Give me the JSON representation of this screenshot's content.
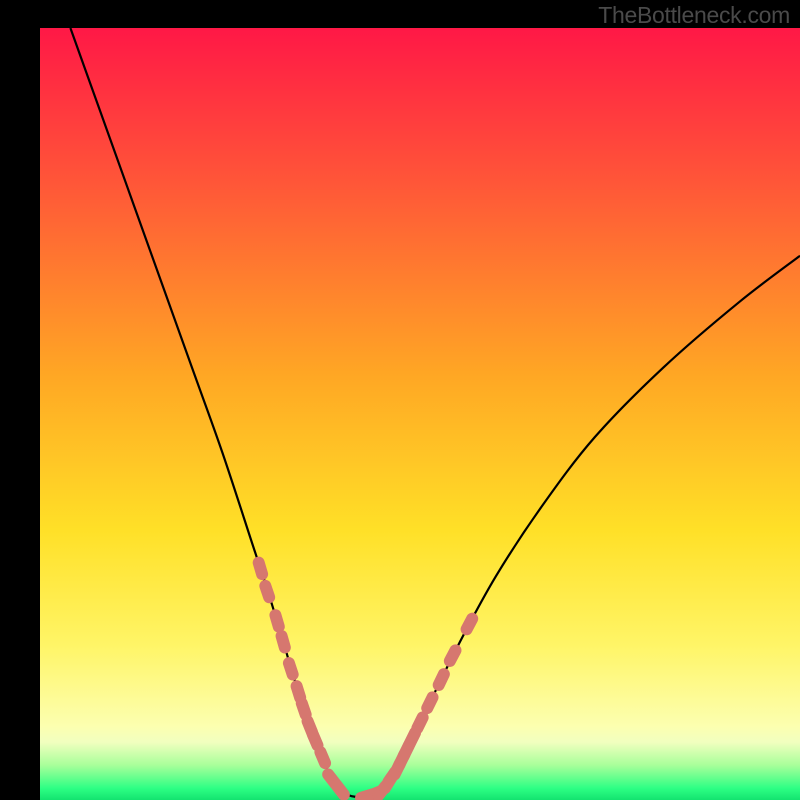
{
  "watermark": "TheBottleneck.com",
  "chart_data": {
    "type": "line",
    "title": "",
    "xlabel": "",
    "ylabel": "",
    "xlim": [
      0,
      100
    ],
    "ylim": [
      0,
      100
    ],
    "series": [
      {
        "name": "curve",
        "x": [
          4,
          8,
          12,
          16,
          20,
          24,
          28,
          30,
          32,
          34,
          36,
          37,
          38,
          39.5,
          41,
          43,
          45,
          47,
          50,
          55,
          60,
          66,
          73,
          82,
          92,
          100
        ],
        "y": [
          100,
          89,
          78,
          67,
          56,
          45,
          33,
          27,
          20.5,
          14,
          8.5,
          6,
          3.5,
          1.3,
          0.5,
          0.5,
          1.2,
          4,
          10,
          20,
          29,
          38,
          47,
          56,
          64.5,
          70.5
        ]
      }
    ],
    "markers_left": {
      "x": [
        29.0,
        29.9,
        31.2,
        32.0,
        33.0,
        34.0,
        34.7,
        35.5,
        36.2,
        37.2,
        38.4,
        39.5
      ],
      "y": [
        30.0,
        27.0,
        23.2,
        20.5,
        17.0,
        14.0,
        11.8,
        9.5,
        7.8,
        5.5,
        2.7,
        1.3
      ]
    },
    "markers_right": {
      "x": [
        43.0,
        44.0,
        45.0,
        45.8,
        46.3,
        47.0,
        47.6,
        48.2,
        49.0,
        50.0,
        51.3,
        52.8,
        54.3,
        56.5
      ],
      "y": [
        0.5,
        0.8,
        1.2,
        2.2,
        3.0,
        4.0,
        5.2,
        6.4,
        8.0,
        10.0,
        12.6,
        15.6,
        18.7,
        22.8
      ]
    },
    "bottom_band": {
      "y0": 0,
      "y1": 7.5
    },
    "gradient_stops": [
      {
        "offset": 0.0,
        "color": "#ff1846"
      },
      {
        "offset": 0.2,
        "color": "#ff5638"
      },
      {
        "offset": 0.45,
        "color": "#ffa724"
      },
      {
        "offset": 0.65,
        "color": "#ffe027"
      },
      {
        "offset": 0.8,
        "color": "#fff567"
      },
      {
        "offset": 0.905,
        "color": "#fcffb0"
      },
      {
        "offset": 0.925,
        "color": "#f1ffbf"
      },
      {
        "offset": 0.955,
        "color": "#a8ff9a"
      },
      {
        "offset": 0.985,
        "color": "#2dff84"
      },
      {
        "offset": 1.0,
        "color": "#13e36f"
      }
    ],
    "marker_color": "#d6776f",
    "curve_color": "#000000"
  }
}
